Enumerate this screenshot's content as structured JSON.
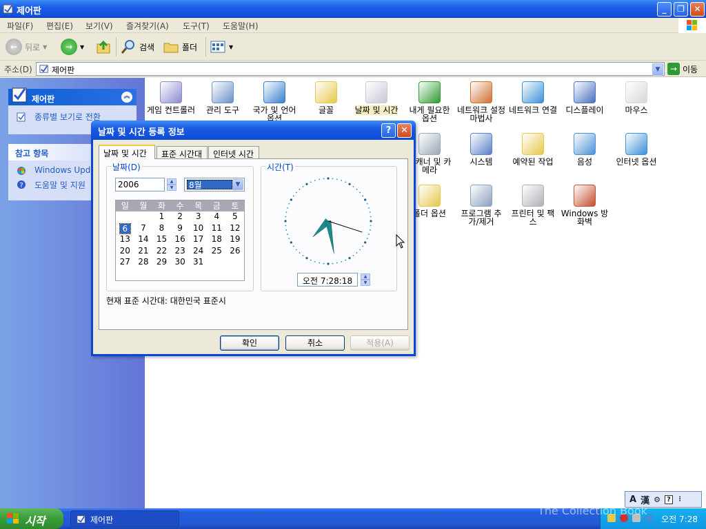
{
  "window": {
    "title": "제어판"
  },
  "menu": [
    "파일(F)",
    "편집(E)",
    "보기(V)",
    "즐겨찾기(A)",
    "도구(T)",
    "도움말(H)"
  ],
  "toolbar": {
    "back": "뒤로",
    "search": "검색",
    "folders": "폴더"
  },
  "address": {
    "label": "주소(D)",
    "value": "제어판",
    "go": "이동"
  },
  "sidebar": {
    "panel1_title": "제어판",
    "panel1_item": "종류별 보기로 전환",
    "panel2_title": "참고 항목",
    "panel2_items": [
      "Windows Update",
      "도움말 및 지원"
    ]
  },
  "icons": [
    {
      "label": "게임 컨트롤러",
      "color": "#8a8ad0"
    },
    {
      "label": "관리 도구",
      "color": "#6c90c8"
    },
    {
      "label": "국가 및 언어 옵션",
      "color": "#3a7fd0"
    },
    {
      "label": "글꼴",
      "color": "#e6c84a"
    },
    {
      "label": "날짜 및 시간",
      "color": "#c8c8d8"
    },
    {
      "label": "내게 필요한 옵션",
      "color": "#2e9a31"
    },
    {
      "label": "네트워크 설정 마법사",
      "color": "#d07030"
    },
    {
      "label": "네트워크 연결",
      "color": "#3a90d8"
    },
    {
      "label": "디스플레이",
      "color": "#4a70c0"
    },
    {
      "label": "마우스",
      "color": "#d8d8d8"
    },
    {
      "label": "스캐너 및 카메라",
      "color": "#9aa8b8"
    },
    {
      "label": "시스템",
      "color": "#5a80c8"
    },
    {
      "label": "예약된 작업",
      "color": "#e6c84a"
    },
    {
      "label": "음성",
      "color": "#4a90d8"
    },
    {
      "label": "인터넷 옵션",
      "color": "#3a90d8"
    },
    {
      "label": "폴더 옵션",
      "color": "#e6c84a"
    },
    {
      "label": "프로그램 추가/제거",
      "color": "#8aa0c0"
    },
    {
      "label": "프린터 및 팩스",
      "color": "#b0b0b8"
    },
    {
      "label": "Windows 방화벽",
      "color": "#c05030"
    }
  ],
  "dialog": {
    "title": "날짜 및 시간 등록 정보",
    "tabs": [
      "날짜 및 시간",
      "표준 시간대",
      "인터넷 시간"
    ],
    "date_group": "날짜(D)",
    "time_group": "시간(T)",
    "year": "2006",
    "month": "8월",
    "weekdays": [
      "일",
      "월",
      "화",
      "수",
      "목",
      "금",
      "토"
    ],
    "first_weekday_index": 2,
    "days_in_month": 31,
    "today": 6,
    "time_text": "오전 7:28:18",
    "clock": {
      "hour": 7,
      "minute": 28,
      "second": 18
    },
    "timezone": "현재 표준 시간대: 대한민국 표준시",
    "ok": "확인",
    "cancel": "취소",
    "apply": "적용(A)"
  },
  "taskbar": {
    "start": "시작",
    "task": "제어판",
    "clock": "오전 7:28",
    "watermark": "The Collection Book"
  }
}
